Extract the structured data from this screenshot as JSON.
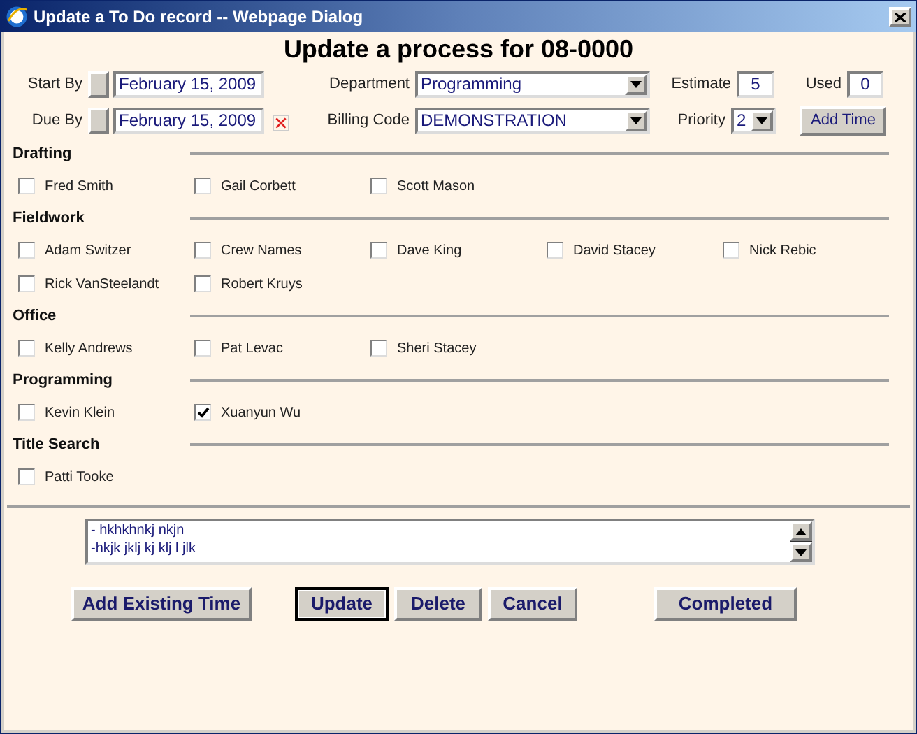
{
  "window": {
    "title": "Update a To Do record -- Webpage Dialog"
  },
  "heading": "Update a process for 08-0000",
  "form": {
    "start_by": {
      "label": "Start By",
      "value": "February 15, 2009"
    },
    "due_by": {
      "label": "Due By",
      "value": "February 15, 2009"
    },
    "department": {
      "label": "Department",
      "value": "Programming"
    },
    "billing_code": {
      "label": "Billing Code",
      "value": "DEMONSTRATION"
    },
    "estimate": {
      "label": "Estimate",
      "value": "5"
    },
    "used": {
      "label": "Used",
      "value": "0"
    },
    "priority": {
      "label": "Priority",
      "value": "2"
    },
    "add_time": "Add Time"
  },
  "groups": [
    {
      "name": "Drafting",
      "members": [
        {
          "name": "Fred Smith",
          "checked": false
        },
        {
          "name": "Gail Corbett",
          "checked": false
        },
        {
          "name": "Scott Mason",
          "checked": false
        }
      ]
    },
    {
      "name": "Fieldwork",
      "members": [
        {
          "name": "Adam Switzer",
          "checked": false
        },
        {
          "name": "Crew Names",
          "checked": false
        },
        {
          "name": "Dave King",
          "checked": false
        },
        {
          "name": "David Stacey",
          "checked": false
        },
        {
          "name": "Nick Rebic",
          "checked": false
        },
        {
          "name": "Rick VanSteelandt",
          "checked": false
        },
        {
          "name": "Robert Kruys",
          "checked": false
        }
      ]
    },
    {
      "name": "Office",
      "members": [
        {
          "name": "Kelly Andrews",
          "checked": false
        },
        {
          "name": "Pat Levac",
          "checked": false
        },
        {
          "name": "Sheri Stacey",
          "checked": false
        }
      ]
    },
    {
      "name": "Programming",
      "members": [
        {
          "name": "Kevin Klein",
          "checked": false
        },
        {
          "name": "Xuanyun Wu",
          "checked": true
        }
      ]
    },
    {
      "name": "Title Search",
      "members": [
        {
          "name": "Patti Tooke",
          "checked": false
        }
      ]
    }
  ],
  "notes": [
    "- hkhkhnkj nkjn",
    "-hkjk jklj kj klj l jlk"
  ],
  "buttons": [
    {
      "label": "Add Existing Time",
      "default": false
    },
    {
      "label": "Update",
      "default": true
    },
    {
      "label": "Delete",
      "default": false
    },
    {
      "label": "Cancel",
      "default": false
    },
    {
      "label": "Completed",
      "default": false
    }
  ]
}
